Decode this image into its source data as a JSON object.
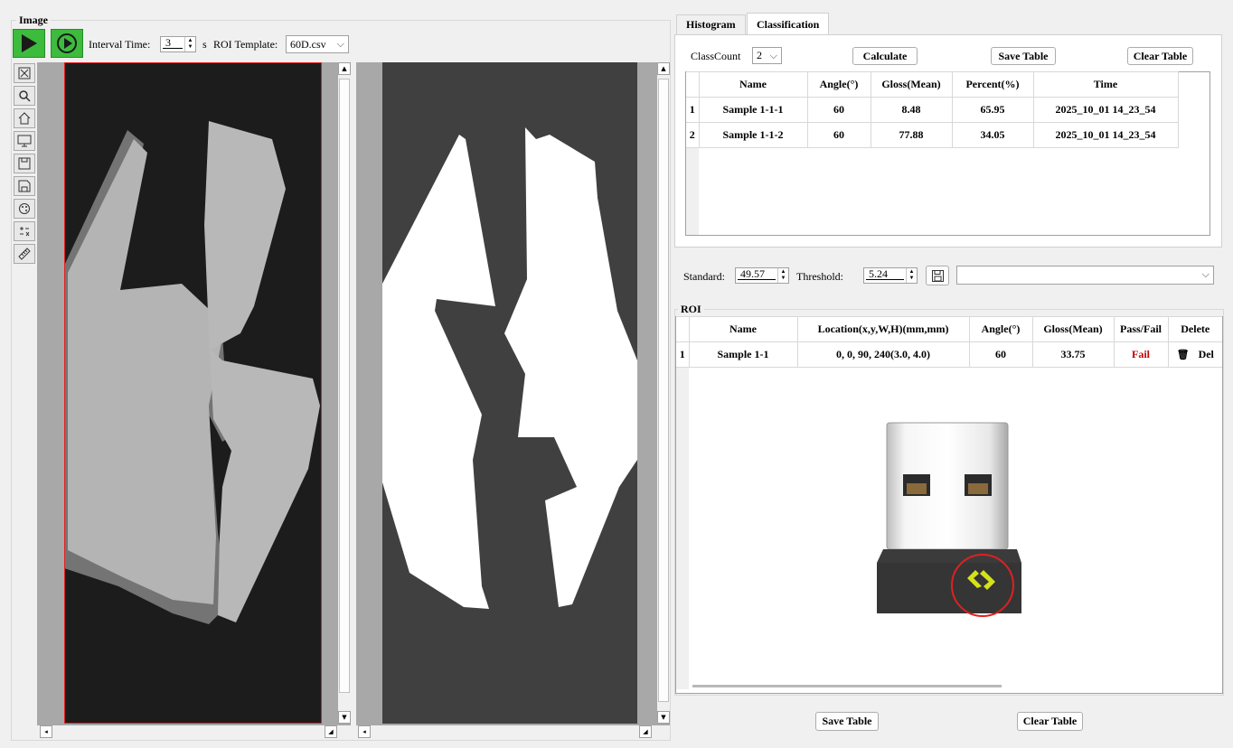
{
  "image_panel": {
    "title": "Image",
    "interval_label": "Interval Time:",
    "interval_value": "3",
    "interval_unit": "s",
    "roi_template_label": "ROI Template:",
    "roi_template_value": "60D.csv"
  },
  "tabs": [
    {
      "label": "Histogram",
      "active": false
    },
    {
      "label": "Classification",
      "active": true
    }
  ],
  "classification": {
    "class_count_label": "ClassCount",
    "class_count_value": "2",
    "calculate_label": "Calculate",
    "save_table_label": "Save Table",
    "clear_table_label": "Clear Table",
    "columns": [
      "Name",
      "Angle(°)",
      "Gloss(Mean)",
      "Percent(%)",
      "Time"
    ],
    "rows": [
      {
        "num": "1",
        "name": "Sample 1-1-1",
        "angle": "60",
        "gloss": "8.48",
        "percent": "65.95",
        "time": "2025_10_01 14_23_54"
      },
      {
        "num": "2",
        "name": "Sample 1-1-2",
        "angle": "60",
        "gloss": "77.88",
        "percent": "34.05",
        "time": "2025_10_01 14_23_54"
      }
    ]
  },
  "standard": {
    "standard_label": "Standard:",
    "standard_value": "49.57",
    "threshold_label": "Threshold:",
    "threshold_value": "5.24"
  },
  "roi": {
    "title": "ROI",
    "columns": [
      "Name",
      "Location(x,y,W,H)(mm,mm)",
      "Angle(°)",
      "Gloss(Mean)",
      "Pass/Fail",
      "Delete"
    ],
    "rows": [
      {
        "num": "1",
        "name": "Sample 1-1",
        "location": "0, 0, 90, 240(3.0, 4.0)",
        "angle": "60",
        "gloss": "33.75",
        "pass_fail": "Fail",
        "delete": "Del"
      }
    ]
  },
  "bottom": {
    "save_table_label": "Save Table",
    "clear_table_label": "Clear Table"
  },
  "colors": {
    "play_green": "#3dbb3d",
    "fail_red": "#c00000",
    "roi_red": "#e02020",
    "logo_yellow": "#d4e21a"
  }
}
